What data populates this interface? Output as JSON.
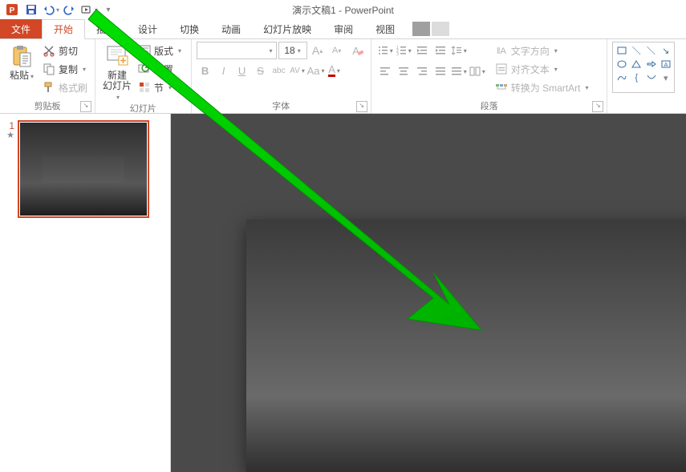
{
  "app": {
    "title": "演示文稿1 - PowerPoint"
  },
  "qat": {
    "save": "save-icon",
    "undo": "undo-icon",
    "redo": "redo-icon",
    "startshow": "start-show-icon"
  },
  "tabs": {
    "file": "文件",
    "home": "开始",
    "insert": "插入",
    "design": "设计",
    "transitions": "切换",
    "animations": "动画",
    "slideshow": "幻灯片放映",
    "review": "审阅",
    "view": "视图"
  },
  "clipboard": {
    "paste": "粘贴",
    "cut": "剪切",
    "copy": "复制",
    "painter": "格式刷",
    "group_label": "剪贴板"
  },
  "slides": {
    "newslide_line1": "新建",
    "newslide_line2": "幻灯片",
    "layout": "版式",
    "reset": "重置",
    "section": "节",
    "group_label": "幻灯片"
  },
  "font": {
    "size": "18",
    "bold": "B",
    "italic": "I",
    "underline": "U",
    "strike": "S",
    "shadow": "abc",
    "spacing": "AV",
    "case": "Aa",
    "color": "A",
    "grow": "A",
    "shrink": "A",
    "clear": "A",
    "group_label": "字体"
  },
  "paragraph": {
    "direction": "文字方向",
    "align_text": "对齐文本",
    "smartart": "转换为 SmartArt",
    "group_label": "段落"
  },
  "thumbnails": {
    "slide1_number": "1"
  },
  "colors": {
    "accent": "#d24726",
    "arrow": "#00d000"
  }
}
